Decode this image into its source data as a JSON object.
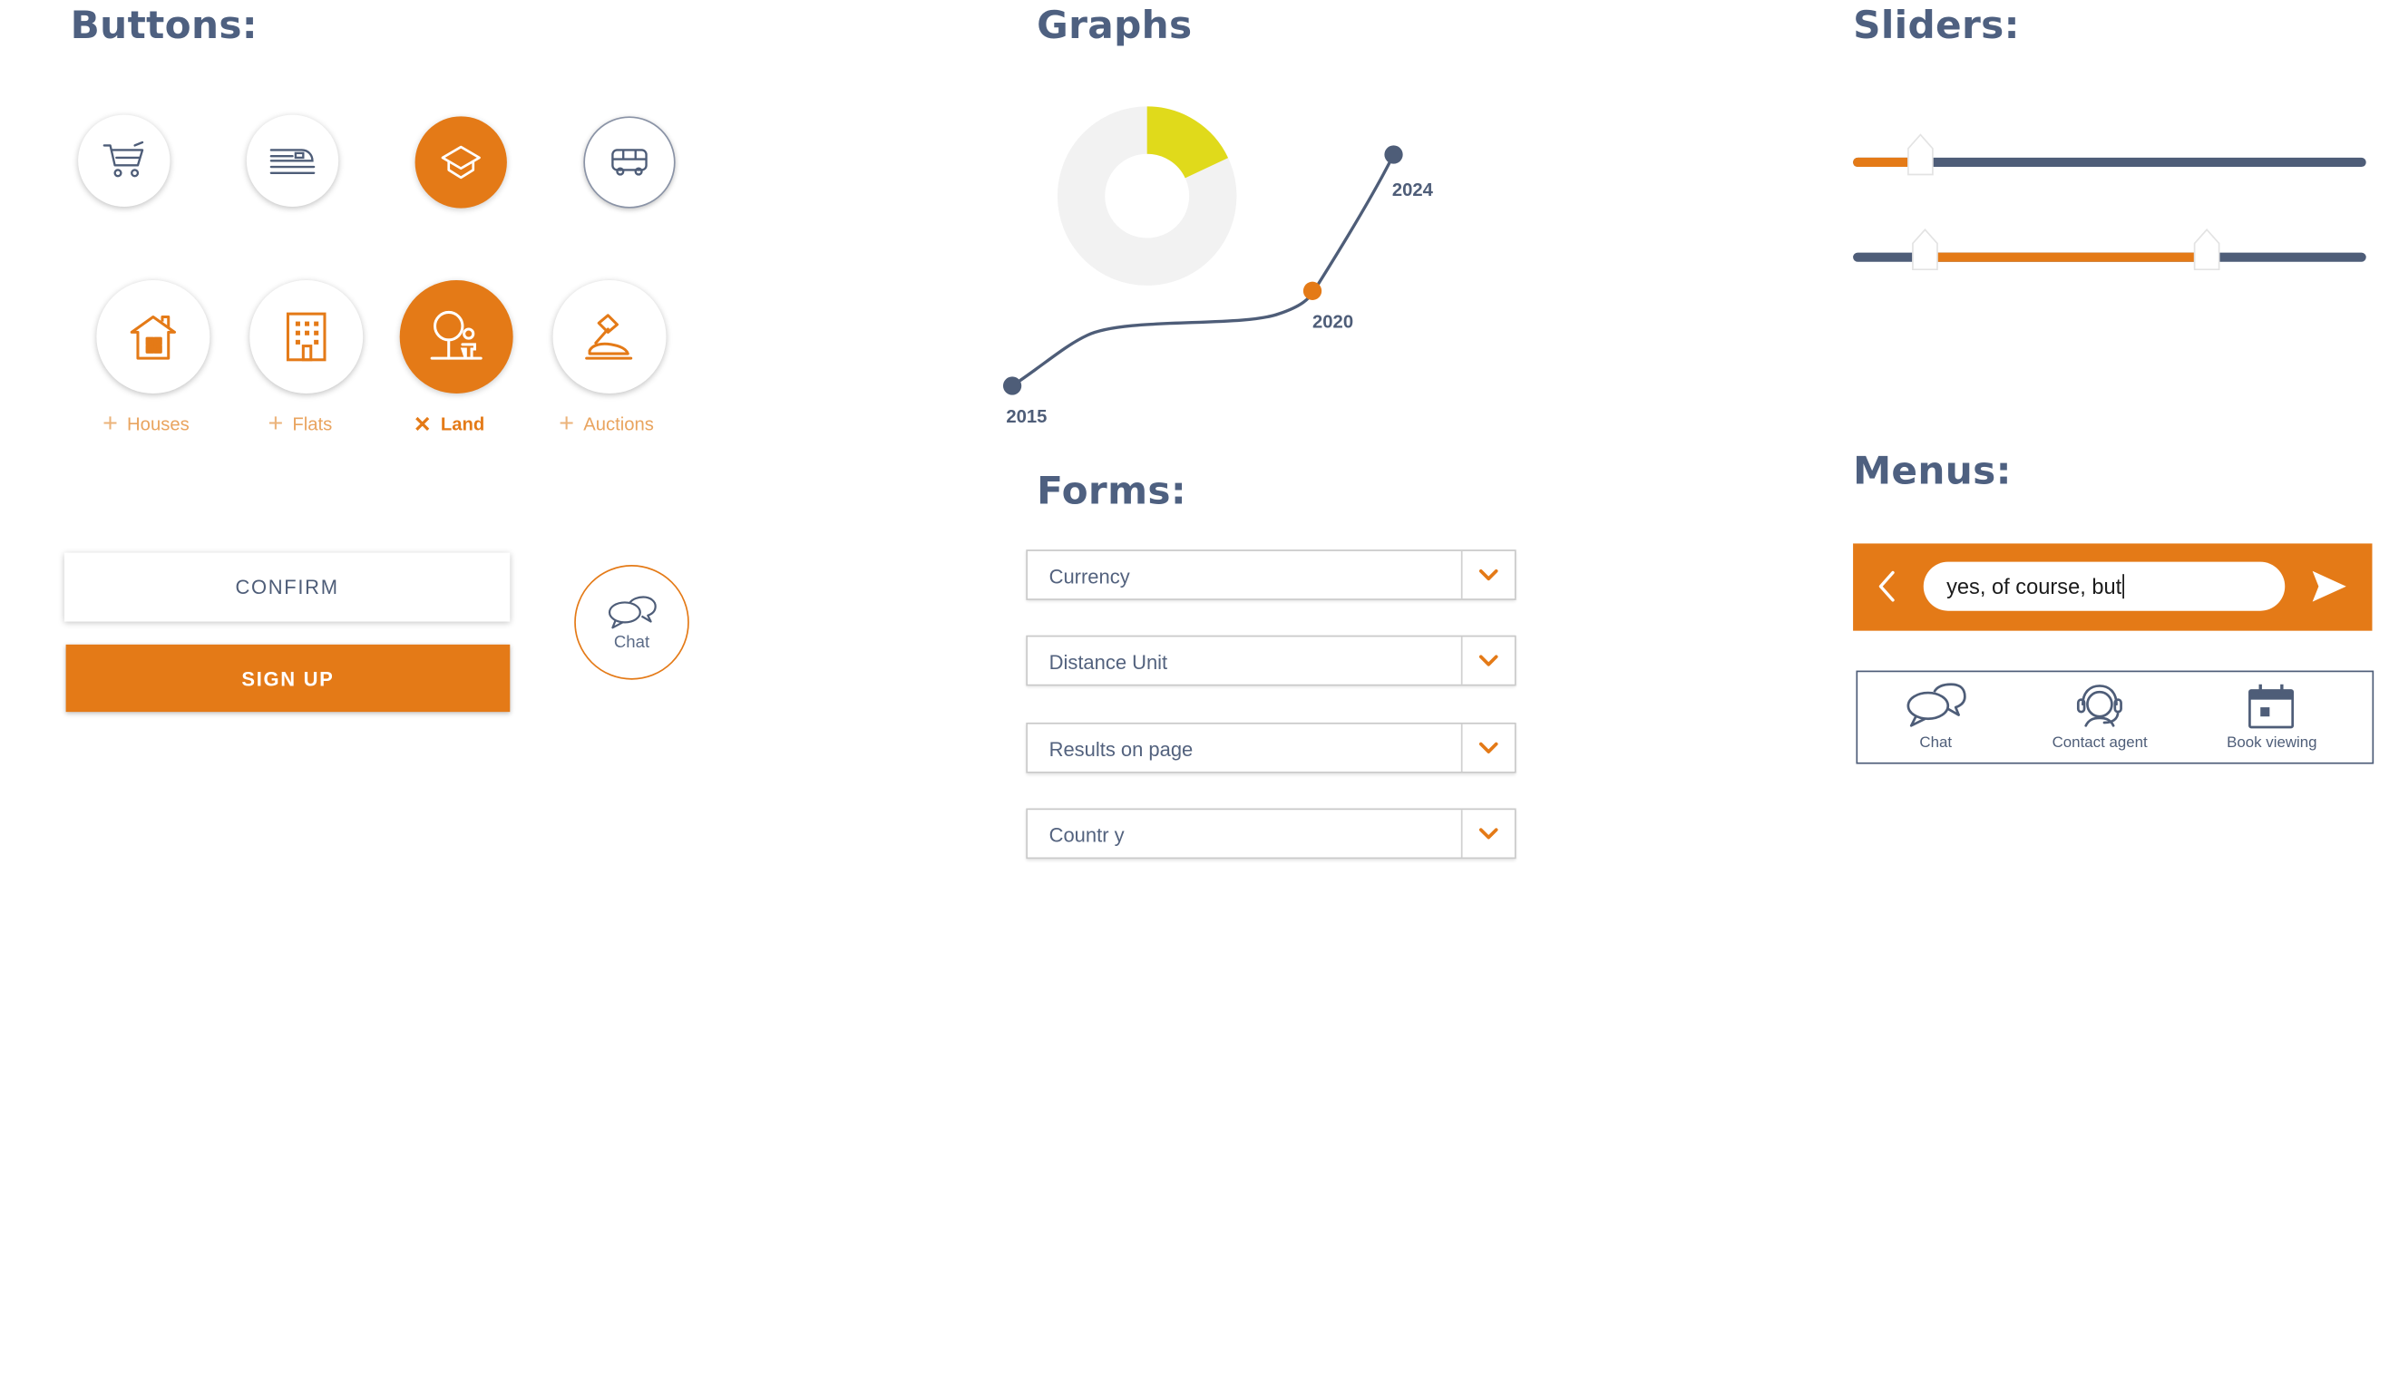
{
  "colors": {
    "accent": "#e47a17",
    "navy": "#4e5d78",
    "lime": "#e0da1b",
    "donut_bg": "#f2f2f2"
  },
  "sections": {
    "buttons": "Buttons:",
    "graphs": "Graphs",
    "sliders": "Sliders:",
    "forms": "Forms:",
    "menus": "Menus:"
  },
  "icon_buttons": [
    {
      "icon": "cart-icon",
      "active": false
    },
    {
      "icon": "train-icon",
      "active": false
    },
    {
      "icon": "graduation-cap-icon",
      "active": true
    },
    {
      "icon": "bus-icon",
      "active": false
    }
  ],
  "property_filters": [
    {
      "icon": "house-icon",
      "label": "Houses",
      "selected": false,
      "symbol": "+"
    },
    {
      "icon": "building-icon",
      "label": "Flats",
      "selected": false,
      "symbol": "+"
    },
    {
      "icon": "tree-icon",
      "label": "Land",
      "selected": true,
      "symbol": "✕"
    },
    {
      "icon": "gavel-icon",
      "label": "Auctions",
      "selected": false,
      "symbol": "+"
    }
  ],
  "buttons": {
    "confirm": "CONFIRM",
    "signup": "SIGN UP",
    "chat": "Chat"
  },
  "graph": {
    "donut_highlight_fraction": 0.18,
    "points": [
      {
        "label": "2015"
      },
      {
        "label": "2020"
      },
      {
        "label": "2024"
      }
    ]
  },
  "forms": {
    "selects": [
      {
        "value": "Currency"
      },
      {
        "value": "Distance Unit"
      },
      {
        "value": "Results on page"
      },
      {
        "value": "Countr y"
      }
    ]
  },
  "sliders": {
    "single": {
      "value": 0.13
    },
    "range": {
      "min": 0.14,
      "max": 0.69
    }
  },
  "chat_input": {
    "value": "yes, of course, but"
  },
  "menu": {
    "items": [
      {
        "icon": "chat-icon",
        "label": "Chat"
      },
      {
        "icon": "headset-icon",
        "label": "Contact agent"
      },
      {
        "icon": "calendar-icon",
        "label": "Book viewing"
      }
    ]
  }
}
